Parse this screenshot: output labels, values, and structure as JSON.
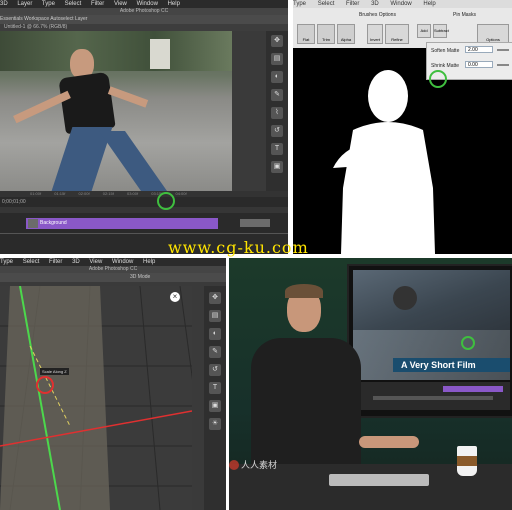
{
  "panel_top_left": {
    "menus": [
      "3D",
      "Layer",
      "Type",
      "Select",
      "Filter",
      "3D",
      "View",
      "Window",
      "Help"
    ],
    "window_title": "Adobe Photoshop CC",
    "options_bar": "Essentials Workspace  Autoselect  Layer",
    "tab_label": "Untitled-1 @ 66.7% (RGB/8)",
    "track_label": "Background",
    "timecode": "0;00;01;00",
    "ruler_ticks": [
      "01:00f",
      "01:15f",
      "02:00f",
      "02:15f",
      "03:00f",
      "03:15f",
      "04:00f",
      "04:15f",
      "05:00f"
    ],
    "tools": [
      "move",
      "layers",
      "adjust",
      "brush",
      "path",
      "history",
      "type",
      "camera"
    ]
  },
  "panel_top_right": {
    "menus": [
      "Type",
      "Select",
      "Filter",
      "3D",
      "Window",
      "Help"
    ],
    "section_view_mode": "Brushes Options",
    "section_mode": "Pin Masks",
    "soften_label": "Soften Matte",
    "soften_value": "2.00",
    "shrink_label": "Shrink Matte",
    "shrink_value": "0.00",
    "buttons": [
      "Flat",
      "Trim",
      "Alpha",
      "Invert",
      "Refine",
      "Add",
      "Subtract",
      "Options"
    ]
  },
  "panel_bottom_left": {
    "menus": [
      "Type",
      "Select",
      "Filter",
      "3D",
      "View",
      "Window",
      "Help"
    ],
    "window_title": "Adobe Photoshop CC",
    "tooltip": "Scale Along Z",
    "view_label": "3D Mode"
  },
  "panel_bottom_right": {
    "screen_title": "A Very Short Film"
  },
  "watermark": "www.cg-ku.com",
  "corner_logo": "人人素材"
}
